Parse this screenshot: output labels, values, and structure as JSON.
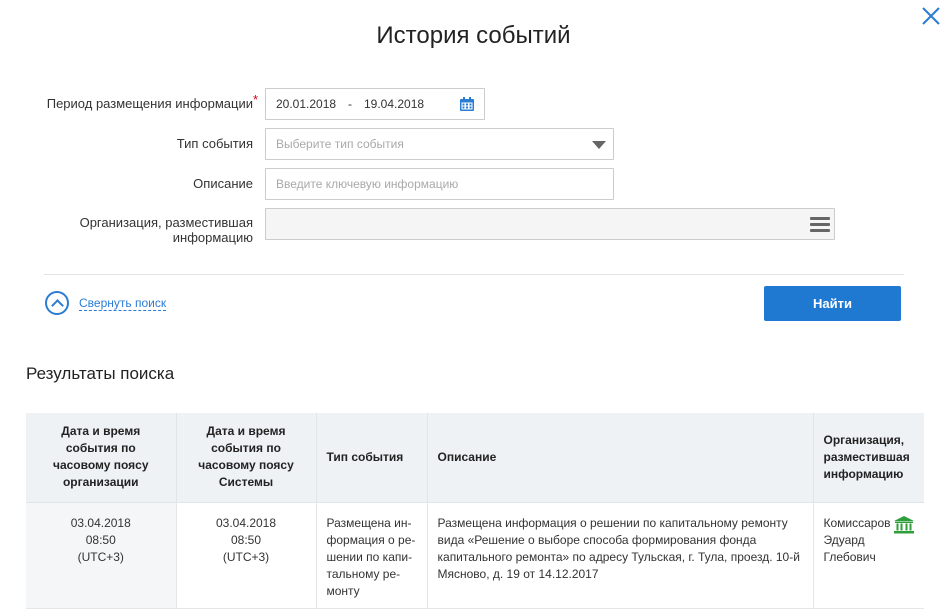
{
  "dialog": {
    "title": "История событий",
    "close_icon": "close-icon"
  },
  "form": {
    "period_label": "Период размещения информации",
    "required_mark": "*",
    "date_from": "20.01.2018",
    "date_separator": "-",
    "date_to": "19.04.2018",
    "calendar_icon": "calendar-icon",
    "event_type_label": "Тип события",
    "event_type_placeholder": "Выберите тип события",
    "description_label": "Описание",
    "description_placeholder": "Введите ключевую информацию",
    "organization_label": "Организация, разместившая\nинформацию",
    "organization_value": "",
    "menu_icon": "menu-icon"
  },
  "actions": {
    "collapse_label": "Свернуть поиск",
    "search_label": "Найти"
  },
  "results": {
    "heading": "Результаты поиска",
    "columns": [
      "Дата и время\nсобытия по\nчасовому поясу\nорганизации",
      "Дата и время\nсобытия по\nчасовому поясу\nСистемы",
      "Тип события",
      "Описание",
      "Организация,\nразместившая\nинформацию"
    ],
    "rows": [
      {
        "org_datetime": "03.04.2018\n08:50\n(UTC+3)",
        "system_datetime": "03.04.2018\n08:50\n(UTC+3)",
        "event_type": "Размещена ин-\nформация о ре-\nшении по капи-\nтальному ре-\nмонту",
        "description": "Размещена информация о решении по капитальному ремонту вида «Решение о выборе способа формирования фонда капитального ремонта» по адресу Тульская, г. Тула, проезд. 10-й Мясново, д. 19 от 14.12.2017",
        "organization": "Комиссаров\nЭдуард\nГлебович",
        "org_icon": "bank-icon",
        "org_icon_color": "#2e9e3a"
      }
    ]
  },
  "colors": {
    "accent": "#1f79d0",
    "link": "#2b7cd3",
    "required": "#d0021b",
    "table_header_bg": "#eef2f5"
  }
}
